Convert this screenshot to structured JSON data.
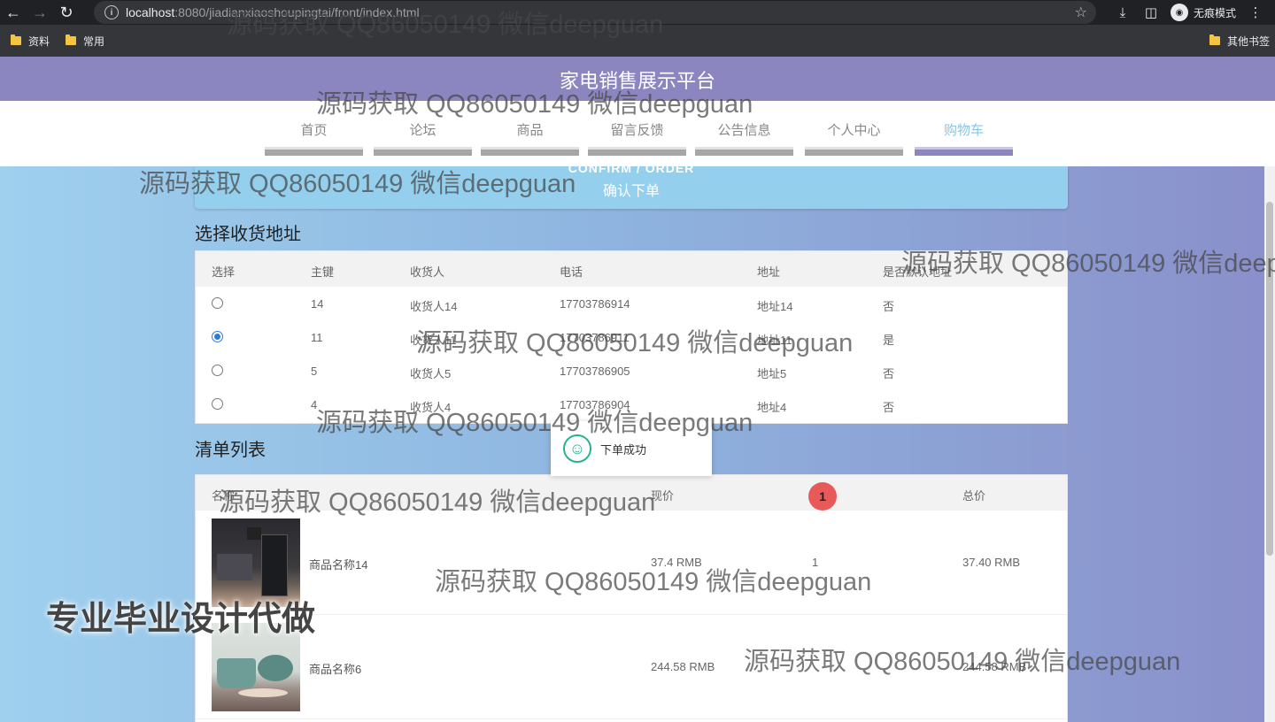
{
  "browser": {
    "url_host": "localhost",
    "url_path": ":8080/jiadianxiaoshoupingtai/front/index.html",
    "incognito_label": "无痕模式",
    "bookmarks": [
      "资料",
      "常用"
    ],
    "other_bookmarks": "其他书签"
  },
  "site": {
    "title": "家电销售展示平台",
    "nav": [
      "首页",
      "论坛",
      "商品",
      "留言反馈",
      "公告信息",
      "个人中心",
      "购物车"
    ],
    "active_nav": "购物车"
  },
  "confirm": {
    "title_en": "CONFIRM / ORDER",
    "title_cn": "确认下单"
  },
  "address_section": {
    "title": "选择收货地址",
    "columns": [
      "选择",
      "主键",
      "收货人",
      "电话",
      "地址",
      "是否默认地址"
    ],
    "rows": [
      {
        "id": "14",
        "name": "收货人14",
        "phone": "17703786914",
        "address": "地址14",
        "default": "否",
        "selected": false
      },
      {
        "id": "11",
        "name": "收货人11",
        "phone": "17703786911",
        "address": "地址11",
        "default": "是",
        "selected": true
      },
      {
        "id": "5",
        "name": "收货人5",
        "phone": "17703786905",
        "address": "地址5",
        "default": "否",
        "selected": false
      },
      {
        "id": "4",
        "name": "收货人4",
        "phone": "17703786904",
        "address": "地址4",
        "default": "否",
        "selected": false
      }
    ]
  },
  "order_list": {
    "title": "清单列表",
    "columns": [
      "名称",
      "现价",
      "数量",
      "总价"
    ],
    "qty_badge": "1",
    "items": [
      {
        "name": "商品名称14",
        "price": "37.4 RMB",
        "quantity": "1",
        "total": "37.40 RMB"
      },
      {
        "name": "商品名称6",
        "price": "244.58 RMB",
        "quantity": "",
        "total": "244.58 RMB"
      }
    ]
  },
  "toast": {
    "message": "下单成功"
  },
  "watermarks": {
    "text": "源码获取 QQ86050149 微信deepguan",
    "promo": "专业毕业设计代做"
  },
  "colors": {
    "header_bg": "#8c86c0",
    "active_nav": "#88c4e8",
    "confirm_bg": "#94d0ee",
    "toast_icon": "#27b391",
    "radio_checked": "#2d7be0"
  }
}
